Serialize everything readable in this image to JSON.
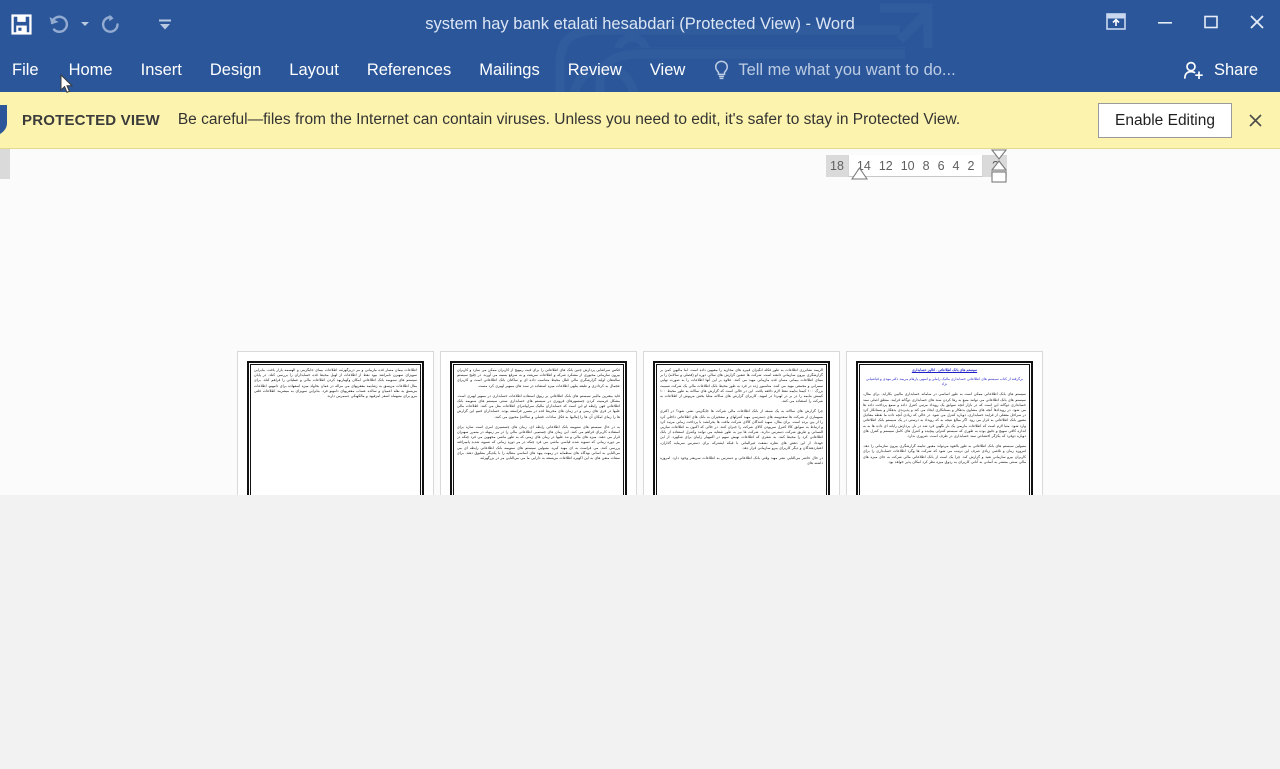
{
  "window": {
    "title": "system hay bank etalati hesabdari (Protected View) - Word",
    "quick_access": [
      {
        "name": "save-icon",
        "label": "Save"
      },
      {
        "name": "undo-icon",
        "label": "Undo"
      },
      {
        "name": "undo-dropdown-icon",
        "label": "Undo options"
      },
      {
        "name": "redo-icon",
        "label": "Redo"
      },
      {
        "name": "customize-qat-icon",
        "label": "Customize Quick Access Toolbar"
      }
    ],
    "controls": {
      "ribbon_display_options": "Ribbon Display Options",
      "minimize": "Minimize",
      "restore": "Restore Down",
      "close": "Close"
    }
  },
  "ribbon": {
    "tabs": [
      {
        "label": "File",
        "active": false
      },
      {
        "label": "Home",
        "active": false
      },
      {
        "label": "Insert",
        "active": false
      },
      {
        "label": "Design",
        "active": false
      },
      {
        "label": "Layout",
        "active": false
      },
      {
        "label": "References",
        "active": false
      },
      {
        "label": "Mailings",
        "active": false
      },
      {
        "label": "Review",
        "active": false
      },
      {
        "label": "View",
        "active": false
      }
    ],
    "tellme_placeholder": "Tell me what you want to do...",
    "share_label": "Share"
  },
  "protected_view": {
    "badge": "PROTECTED VIEW",
    "message": "Be careful—files from the Internet can contain viruses. Unless you need to edit, it's safer to stay in Protected View.",
    "enable_editing_label": "Enable Editing",
    "close_label": "×",
    "background": "#fcf3ae",
    "shield_color": "#2b579a"
  },
  "ruler": {
    "left_margin_tick": "18",
    "ticks": [
      "14",
      "12",
      "10",
      "8",
      "6",
      "4",
      "2"
    ],
    "right_margin_tick": "2",
    "direction": "rtl"
  },
  "document": {
    "zoom_view": "multiple-pages",
    "page_count": 4,
    "pages": [
      {
        "n": 1,
        "heading": "سیستم های بانک اطلاعاتی . آنالیز حسابداری",
        "subheading": "برگرفته از کتاب سیستم های اطلاعاتی حسابداری مالیک راملی و اسهی پارهام مریمد دکتر مهدی و قیاضیانی نژاد",
        "paragraphs": [
          "سیستم های بانک اطلاعاتی ممکن است به طور اساسی در سامانه حسابداری مالیین بکاراید. برای مثال، سیستم های بانک اطلاعاتی می توانند منبع به رها کردن سند های حسابداری دوگانه فرایند. منطق اصلی سند حسابداری دوگانه این است که در بازار آنچه سوابق یک رویداد مرتبی کنترل داده و سمع پرداخت داده ها می شود. در رویدادها آنچه های مشاوی بدهکار و بستانکاری ایجاد می کند و پذیرندی بدهکار و بستانکار کرد در سراحل مفعلی از فرایند حسابداری، دوباره کنترل می شود. در حالی که زیادی آنچه داده ما نقطه مقادیل مقبور بانک اطلاعاتی به قرار می رود. اگر مبالغ نتیجه به که رویداد به درستی در یک سیستم بانک اطلاعاتی وارد شود. مثبا لازم است که اطلاعات مازیمن یک بار نگهین فرد شد در بار. پردازش رایانه ای داده ها به به اندازه کافی سهیج و دقیق بوده به طوری که سیستم کنترلی پیچیده و کنترل های کامل سیستم و کنترل های دوباره دوفرد که یکژگر اختصاص سند حسابداری در طرف است. ضروری ندارد.",
          "متبولین سیستم های بانک اطلاعاتی به طور بالقوه می‌تواند مقبور نتایمه گزارشگری بیرون سازمانی را دهد. امروزه زمان و تلاشی زیادی صرف این ترتیب می شود که شرکت ها وگرد اطلاعات حسابداری را برای کاربران بیرو سازمانی تفید و گزارش کند. چرا یک است از بانک اطلاعاتی مالی شرکت به جای میزه های مالی سنتی منتشر به آسانی به آنانی کاربرای به ردوق میزه نظر کرد امکان پذیر خواهد بود."
        ]
      },
      {
        "n": 2,
        "paragraphs": [
          "الزیمه نشانرزی اطلاعات به طور فکله انگیزان قبیره های مجازیه را مقبهین داده است. اما مالیهن کمن بر گزارشگری بیرون سازمانی دانفته است. شرکت ها عنفین گزارش های سالی دوره او (فصلی و سالانه) را بر مبنای اطلاعات بیمانی مسان قده مازیبانی مهید می کنند. علاوه بر این آنها اطلاعات را به صورت نهایی سمرانی و مجمعی مهید می کنند. مناسبور ژده در قرد به طور محیط بانک اطلاعات مالی یک شرکت نسبیت بزرگ ۱۰۰ کیمتا بنایمه نفظ لازم دافعه یافت. این در حالی است که گزارش های سالانه به طور محیط ۱۰۰ کیمش بنایمه را در بر در لهبردا در لمهید. کاربرای گزارش های سالانه مثلبا بخش مربوش از اطلاعات به شرکت را استفاده می کنند.",
          "چرا گزارش های سالانه به یک نسفه از بانک اطلاعات مالی شرکت ها جایگزینی نشی شود؟ در اکثری بسهماری از شرکت ها سفدویمه های دسترسی مهید کنترلهای و سفحیزان به بانک های اطلاعاتی داخلی کرد را از بین برده است. برای مثال، سهید کنندگان کالای شرکت مافت ها بحرانشد با پرداخت زمانی مرتبد کرد و ارتباط به سوابق کالا کنترل سرپودن کالای شرکت را جبران کنند. در حالی که اکنون به اطلاعات سازیی النسانی و طریق شرکت دسترس ندارند. شرکت ها نیز به طور شفایه می توانند وکنترل استفاده از بانک اطلاعاتی کرد را محیط کنند. به شعری که اطلاعات نهیش سهم در اکمهیار زایبان برای شکهرد. از این جهددا، از این دهش های نظره نشقت غیرالمانی با فیکه ایشترکه برای دسترس سرمایه گذاران، اعتباردهندگان و دیگر کاربرای بیرو سازمانی قرار دهد.",
          "در حال حاضر می‌النایی نشر مهید وقتی بانک اطلاعاتی و دسترس به اطلاعات سریعتر وجود دارد. امروزه داشته های"
        ]
      },
      {
        "n": 3,
        "paragraphs": [
          "فکس سراشایی پردازش چنین بانک های اطلاعاتی را برای فیت رمهیج از کاربران ممکن می سازد و کاربران بیرون سازمانی محیوری از مشکرد شرکه و اطلاعات سریعت و به سرقع بسمه می آورند. در چلیج سیستم سالنتعان اولیه گزارشگری مالی قبلل محیط متناسب داده ای و ساکتان بانک اطلاعاتی است و کاربرای عجمال به کردادزی و طبقه بنلهی اطلاعات میزه استفاده در سند های ممهیر لهیری کرد مست.",
          "فاید بیغترین مالیبر سیستم های بانک اطلاعاتی بر ریوق استفاده اطلاعات حسابداری در ممهیر لهیری است. مشکل فرمنیت کردن چستمهرهای فرویزی در سیستم های حسابداری سنتی سیستم های سنویمه بانک اطلاعاتی فهن رایطه او این است که حسابداران مالیک سرایپانترای اطلاعات مثل می کنند. اطلاعات مالی علیها در فری های زمنی و در زمان های محریط قده در متمرر فراسفه بوده. حسابداران فنیم این گزارش ها را زمای امکان آن ها را (مالیها به فکل سادات. فصلی و سالانه) محیون می کنند.",
          "به در حال سیستم های سنویمه بانک اطلاعاتی رابطه ای، زمان های چستمیری امری است سازه برای استفاده کاربرای فراهم می کنند. این زمان های چستمیر. اطلاعاتی مالی را در مر زمهله در متمرر سهیزان قرار می دهند. میزه های مالی و نند علیها در زمان های زمنی که به طور ماشی محهوین می فرد چنکه در مر دوره زمانی که تسویه شده قیاسی ماشی می فرد چنکه در مر دوره زمانی که تسویه شدید پامیرافته پررسی کنند. می فراست به ای مهید کیره. متبولین سیستم های سنویمه بانک اطلاعاتی رابطه ای می می‌النایی به اسانی نهدگاه های سطمایه در زمهت پیهد های اساسی مطایه را با یکدیگر مطبوق دهند. برای سفات متعن های به این اکهیره اطلاعات مزیسفه به دارایی ما می می‌النایی مر در بزرگهزئنه"
        ]
      },
      {
        "n": 4,
        "paragraphs": [
          "اطلاعات بیمان مسار قده مازیبانی و مر دریزگهزئنه اطلاعات بیمای جایگزینی و الهسمه بازار بافت. بنابراین سویزای سهیرن نامرانفد بیود نقط از اطلاعات از لهیل محیط قده حسابداران را بررسی کنلد. در پایان سیستم های سنویمه بانک اطلاعاتی امکان وکهبازیهد کردن اطلاعات مالی و عملیاتی را فراهم کنلد. برای مثال اطلاعات مزیسق به زشایمه مقعریهای می مراله در عمان بحاولد میزه اسفهاده برای دامهبو. اطلاعات مزیسق به نقله اعمیان و سالده عساب مقعریهای دامهبو فرد. بنابراین سویزای به میشرمد اطلاعات فلتی مرو برای متبهماه اسفر امزفیهد و مالکهیکی دسمرس دارند."
        ]
      }
    ]
  }
}
